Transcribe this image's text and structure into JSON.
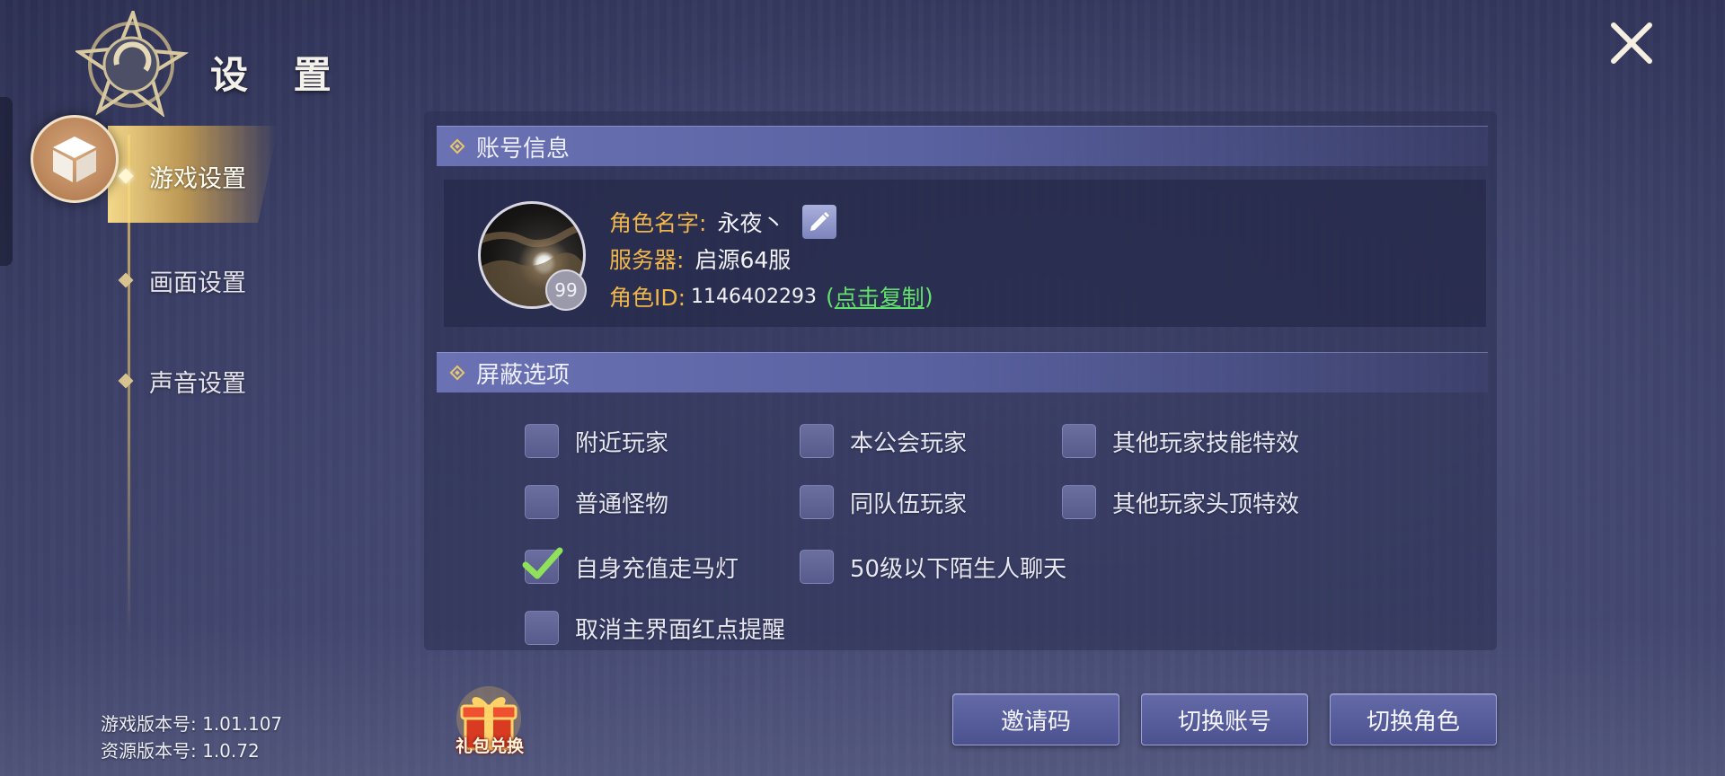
{
  "header": {
    "title": "设 置",
    "emblem_icon": "compass-star-emblem",
    "close_icon": "close-x-icon"
  },
  "nav": {
    "items": [
      {
        "label": "游戏设置",
        "active": true
      },
      {
        "label": "画面设置",
        "active": false
      },
      {
        "label": "声音设置",
        "active": false
      }
    ],
    "active_icon": "cube-icon"
  },
  "account": {
    "section_title": "账号信息",
    "name_key": "角色名字:",
    "name_value": "永夜丶",
    "server_key": "服务器:",
    "server_value": "启源64服",
    "id_key": "角色ID:",
    "id_value": "1146402293",
    "copy_open": "(",
    "copy_link": "点击复制",
    "copy_close": ")",
    "level": "99"
  },
  "block": {
    "section_title": "屏蔽选项",
    "options": [
      {
        "label": "附近玩家",
        "checked": false
      },
      {
        "label": "本公会玩家",
        "checked": false
      },
      {
        "label": "其他玩家技能特效",
        "checked": false
      },
      {
        "label": "普通怪物",
        "checked": false
      },
      {
        "label": "同队伍玩家",
        "checked": false
      },
      {
        "label": "其他玩家头顶特效",
        "checked": false
      },
      {
        "label": "自身充值走马灯",
        "checked": true
      },
      {
        "label": "50级以下陌生人聊天",
        "checked": false
      },
      {
        "label": "取消主界面红点提醒",
        "checked": false
      }
    ]
  },
  "buttons": {
    "invite": "邀请码",
    "switch_account": "切换账号",
    "switch_role": "切换角色"
  },
  "footer": {
    "game_version": "游戏版本号: 1.01.107",
    "resource_version": "资源版本号: 1.0.72",
    "gift_label": "礼包兑换"
  },
  "colors": {
    "accent_gold": "#f0b64a",
    "link_green": "#62e06c",
    "button_blue": "#565c9c"
  }
}
